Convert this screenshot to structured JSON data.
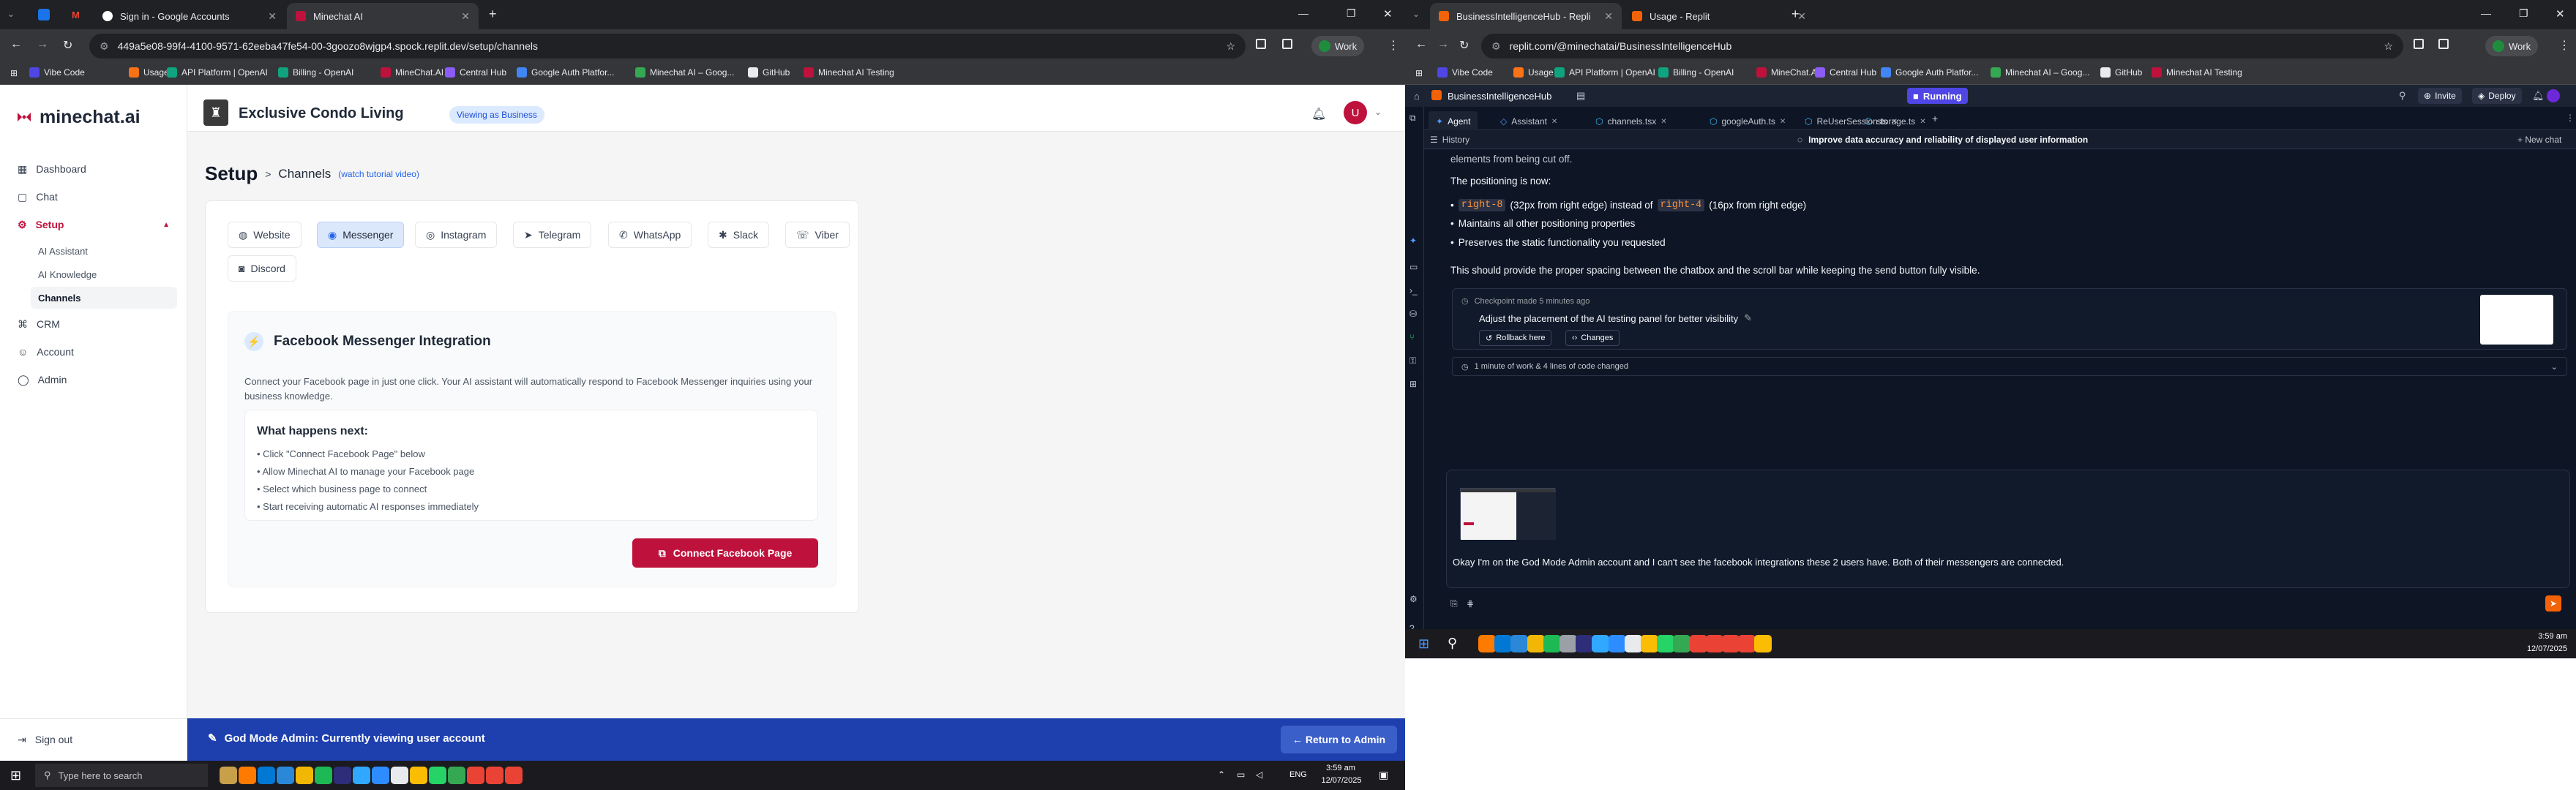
{
  "left_window": {
    "tabs": [
      {
        "title": "Sign in - Google Accounts"
      },
      {
        "title": "Minechat AI"
      }
    ],
    "address": "449a5e08-99f4-4100-9571-62eeba47fe54-00-3goozo8wjgp4.spock.replit.dev/setup/channels",
    "profile": "Work",
    "bookmarks": [
      "Vibe Code",
      "Usage",
      "API Platform | OpenAI",
      "Billing - OpenAI",
      "MineChat.AI",
      "Central Hub",
      "Google Auth Platfor...",
      "Minechat AI – Goog...",
      "GitHub",
      "Minechat AI Testing"
    ],
    "bookmark_colors": [
      "#4f46e5",
      "#f97316",
      "#10a37f",
      "#10a37f",
      "#be123c",
      "#8b5cf6",
      "#4285f4",
      "#34a853",
      "#e8eaed",
      "#be123c"
    ]
  },
  "app": {
    "brand": "minechat.ai",
    "business_name": "Exclusive Condo Living",
    "viewing_badge": "Viewing as Business",
    "avatar_letter": "U",
    "nav": [
      {
        "label": "Dashboard",
        "icon": "grid-icon"
      },
      {
        "label": "Chat",
        "icon": "chat-icon"
      },
      {
        "label": "Setup",
        "icon": "gear-icon"
      },
      {
        "label": "AI Assistant"
      },
      {
        "label": "AI Knowledge"
      },
      {
        "label": "Channels"
      },
      {
        "label": "CRM",
        "icon": "crm-icon"
      },
      {
        "label": "Account",
        "icon": "user-icon"
      },
      {
        "label": "Admin",
        "icon": "shield-icon"
      }
    ],
    "signout": "Sign out",
    "page_title": "Setup",
    "breadcrumb_sep": ">",
    "breadcrumb": "Channels",
    "tutorial_link": "(watch tutorial video)",
    "channels": [
      "Website",
      "Messenger",
      "Instagram",
      "Telegram",
      "WhatsApp",
      "Slack",
      "Viber",
      "Discord"
    ],
    "integration_title": "Facebook Messenger Integration",
    "integration_desc": "Connect your Facebook page in just one click. Your AI assistant will automatically respond to Facebook Messenger inquiries using your business knowledge.",
    "next_title": "What happens next:",
    "next_steps": [
      "• Click \"Connect Facebook Page\" below",
      "• Allow Minechat AI to manage your Facebook page",
      "• Select which business page to connect",
      "• Start receiving automatic AI responses immediately"
    ],
    "connect_button": "Connect Facebook Page",
    "admin_banner": "God Mode Admin: Currently viewing user account",
    "return_button": "← Return to Admin",
    "colors": {
      "brand": "#be123c",
      "banner": "#1e40af",
      "messenger_sel": "#dbe7fb"
    }
  },
  "left_taskbar": {
    "search_placeholder": "Type here to search",
    "time": "3:59 am",
    "date": "12/07/2025",
    "lang": "ENG"
  },
  "right_window": {
    "tabs": [
      {
        "title": "BusinessIntelligenceHub - Repli"
      },
      {
        "title": "Usage - Replit"
      }
    ],
    "address": "replit.com/@minechatai/BusinessIntelligenceHub",
    "profile": "Work",
    "bookmarks": [
      "Vibe Code",
      "Usage",
      "API Platform | OpenAI",
      "Billing - OpenAI",
      "MineChat.AI",
      "Central Hub",
      "Google Auth Platfor...",
      "Minechat AI – Goog...",
      "GitHub",
      "Minechat AI Testing"
    ],
    "project": "BusinessIntelligenceHub",
    "status": "Running",
    "invite": "Invite",
    "deploy": "Deploy",
    "file_tabs": [
      "Agent",
      "Assistant",
      "channels.tsx",
      "googleAuth.ts",
      "ReUserSession.ts",
      "storage.ts"
    ],
    "history": "History",
    "thread_title": "Improve data accuracy and reliability of displayed user information",
    "new_chat": "+ New chat",
    "cut_line": "elements from being cut off.",
    "positioning_now": "The positioning is now:",
    "bullets": [
      {
        "code": "right-8",
        "text": "(32px from right edge) instead of",
        "code2": "right-4",
        "text2": "(16px from right edge)"
      },
      {
        "text": "Maintains all other positioning properties"
      },
      {
        "text": "Preserves the static functionality you requested"
      }
    ],
    "summary": "This should provide the proper spacing between the chatbox and the scroll bar while keeping the send button fully visible.",
    "checkpoint_label": "Checkpoint made 5 minutes ago",
    "checkpoint_title": "Adjust the placement of the AI testing panel for better visibility",
    "rollback": "Rollback here",
    "changes": "Changes",
    "work_summary": "1 minute of work & 4 lines of code changed",
    "user_message": "Okay I'm on the God Mode Admin account and I can't see the facebook integrations these 2 users have. Both of their messengers are connected."
  },
  "right_taskbar": {
    "time": "3:59 am",
    "date": "12/07/2025"
  }
}
